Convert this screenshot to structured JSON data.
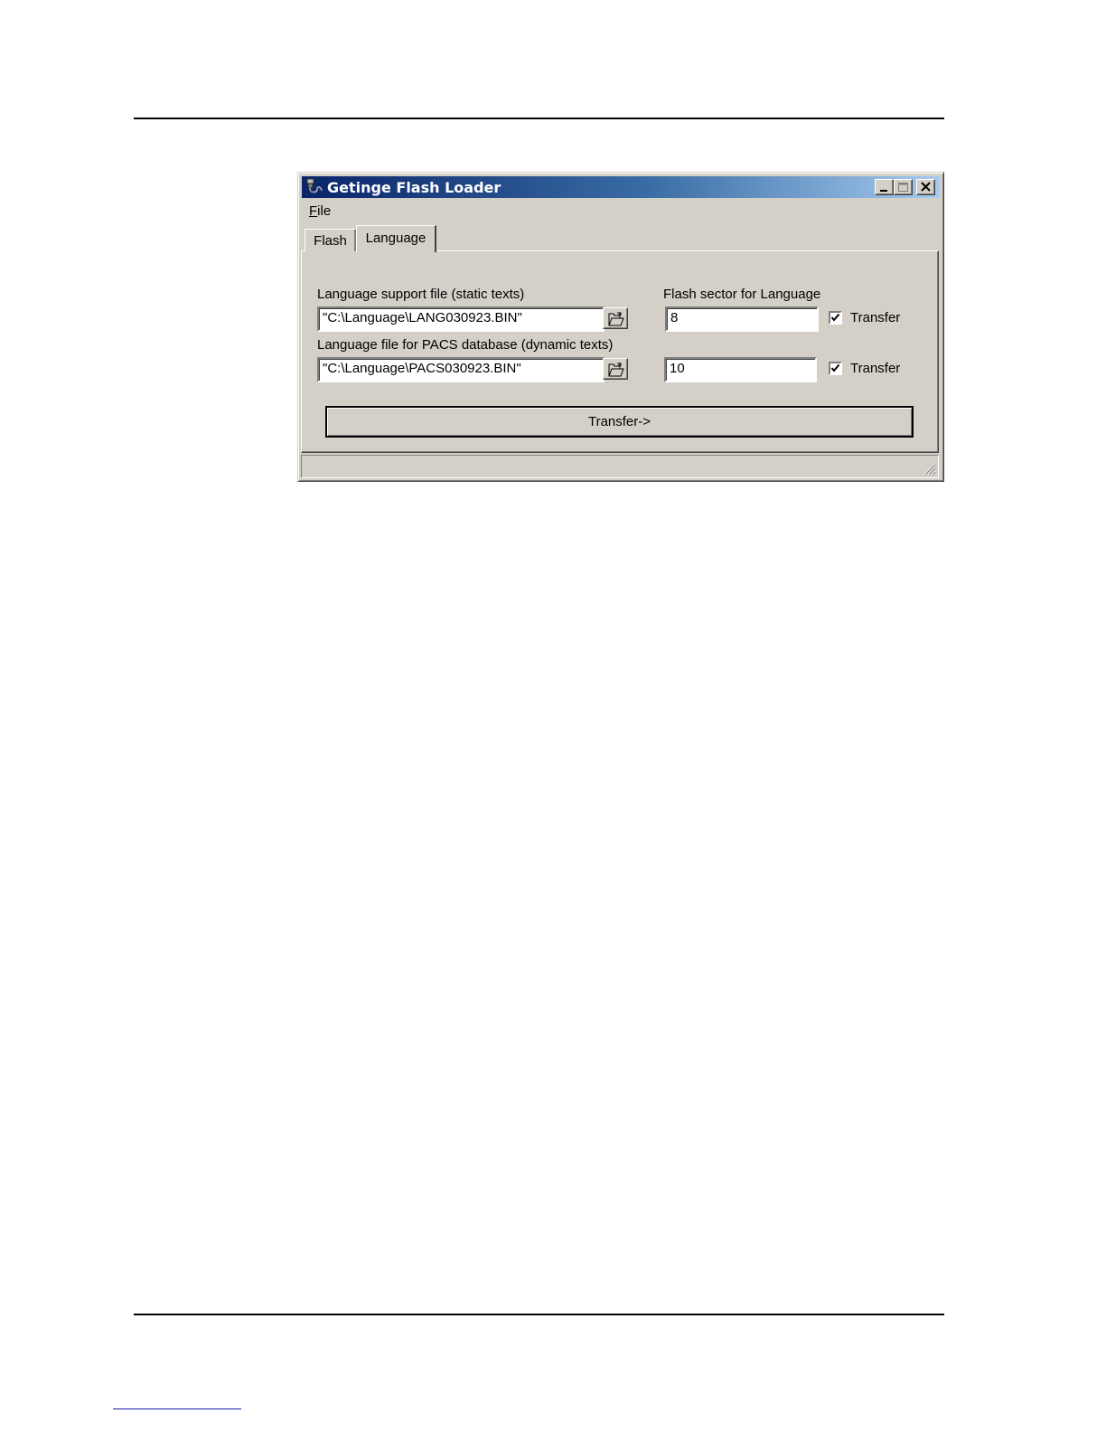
{
  "window": {
    "title": "Getinge Flash Loader"
  },
  "menu": {
    "file_prefix": "F",
    "file_rest": "ile"
  },
  "tabs": [
    {
      "label": "Flash",
      "selected": false
    },
    {
      "label": "Language",
      "selected": true
    }
  ],
  "language_tab": {
    "static_label": "Language support file (static texts)",
    "static_path": "\"C:\\Language\\LANG030923.BIN\"",
    "dynamic_label": "Language file for PACS database (dynamic texts)",
    "dynamic_path": "\"C:\\Language\\PACS030923.BIN\"",
    "sector_label": "Flash sector for Language",
    "sector_static": "8",
    "sector_dynamic": "10",
    "transfer_check_1": {
      "label": "Transfer",
      "checked": true
    },
    "transfer_check_2": {
      "label": "Transfer",
      "checked": true
    },
    "transfer_button": "Transfer->"
  },
  "icons": {
    "app": "flash-loader-app-icon",
    "minimize": "minimize-icon",
    "maximize": "maximize-icon",
    "close": "close-icon",
    "browse": "open-folder-icon",
    "grip": "resize-grip-icon"
  }
}
